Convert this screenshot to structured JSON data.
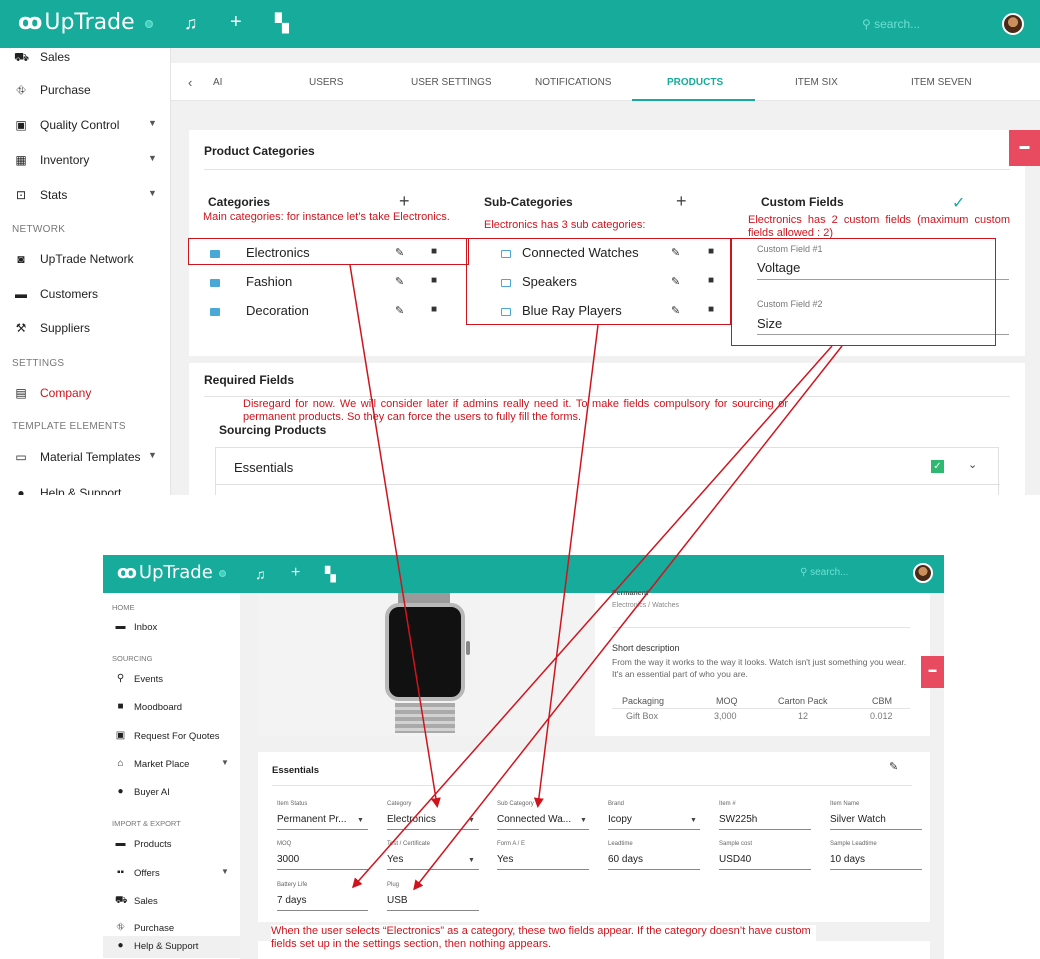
{
  "top": {
    "brand": "UpTrade",
    "search_placeholder": "search...",
    "sidebar": {
      "items": [
        {
          "label": "Sales"
        },
        {
          "label": "Purchase"
        },
        {
          "label": "Quality Control"
        },
        {
          "label": "Inventory"
        },
        {
          "label": "Stats"
        },
        {
          "label": "UpTrade Network"
        },
        {
          "label": "Customers"
        },
        {
          "label": "Suppliers"
        },
        {
          "label": "Company"
        },
        {
          "label": "Material Templates"
        },
        {
          "label": "Help & Support"
        }
      ],
      "sections": [
        "NETWORK",
        "SETTINGS",
        "TEMPLATE ELEMENTS"
      ]
    },
    "tabs": [
      "AI",
      "USERS",
      "USER SETTINGS",
      "NOTIFICATIONS",
      "PRODUCTS",
      "ITEM SIX",
      "ITEM SEVEN"
    ],
    "active_tab": "PRODUCTS",
    "product_categories": {
      "title": "Product Categories",
      "categories_head": "Categories",
      "subcategories_head": "Sub-Categories",
      "custom_fields_head": "Custom Fields",
      "categories": [
        "Electronics",
        "Fashion",
        "Decoration"
      ],
      "subcategories": [
        "Connected Watches",
        "Speakers",
        "Blue Ray Players"
      ],
      "custom_fields": [
        {
          "label": "Custom Field #1",
          "value": "Voltage"
        },
        {
          "label": "Custom Field #2",
          "value": "Size"
        }
      ]
    },
    "required_fields": {
      "title": "Required Fields",
      "sourcing_products": "Sourcing Products",
      "essentials": "Essentials"
    }
  },
  "notes": {
    "categories": "Main categories: for instance let’s take Electronics.",
    "subcategories": "Electronics has 3 sub categories:",
    "custom_fields": "Electronics has 2 custom fields (maximum custom fields allowed : 2)",
    "required": "Disregard for now. We will consider later if admins really need it. To make fields compulsory for sourcing or permanent products. So they can force the users to fully fill the forms.",
    "bottom": "When the user selects “Electronics” as a category, these two fields appear. If the category doesn’t have custom fields set up in the settings section, then nothing appears."
  },
  "bottom": {
    "brand": "UpTrade",
    "search_placeholder": "search...",
    "sidebar": {
      "sections": [
        "HOME",
        "SOURCING",
        "IMPORT & EXPORT"
      ],
      "items": [
        {
          "label": "Inbox"
        },
        {
          "label": "Events"
        },
        {
          "label": "Moodboard"
        },
        {
          "label": "Request For Quotes"
        },
        {
          "label": "Market Place"
        },
        {
          "label": "Buyer AI"
        },
        {
          "label": "Products"
        },
        {
          "label": "Offers"
        },
        {
          "label": "Sales"
        },
        {
          "label": "Purchase"
        },
        {
          "label": "Help & Support"
        }
      ]
    },
    "product": {
      "type": "Permanent",
      "path": "Electronics / Watches",
      "short_desc_title": "Short description",
      "short_desc": "From the way it works to the way it looks. Watch isn't just something you wear. It's an essential part of who you are.",
      "pack_headers": [
        "Packaging",
        "MOQ",
        "Carton Pack",
        "CBM"
      ],
      "pack_values": [
        "Gift Box",
        "3,000",
        "12",
        "0.012"
      ]
    },
    "essentials": {
      "title": "Essentials",
      "fields": [
        {
          "label": "Item Status",
          "value": "Permanent Pr..."
        },
        {
          "label": "Category",
          "value": "Electronics"
        },
        {
          "label": "Sub Category",
          "value": "Connected Wa..."
        },
        {
          "label": "Brand",
          "value": "Icopy"
        },
        {
          "label": "Item #",
          "value": "SW225h"
        },
        {
          "label": "Item Name",
          "value": "Silver Watch"
        },
        {
          "label": "MOQ",
          "value": "3000"
        },
        {
          "label": "Test / Certificate",
          "value": "Yes"
        },
        {
          "label": "Form A / E",
          "value": "Yes"
        },
        {
          "label": "Leadtime",
          "value": "60 days"
        },
        {
          "label": "Sample cost",
          "value": "USD40"
        },
        {
          "label": "Sample Leadtime",
          "value": "10 days"
        },
        {
          "label": "Battery Life",
          "value": "7 days"
        },
        {
          "label": "Plug",
          "value": "USB"
        }
      ]
    }
  },
  "colors": {
    "accent": "#17ab9b",
    "annotation": "#d0141e",
    "flag": "#e84a5f"
  }
}
